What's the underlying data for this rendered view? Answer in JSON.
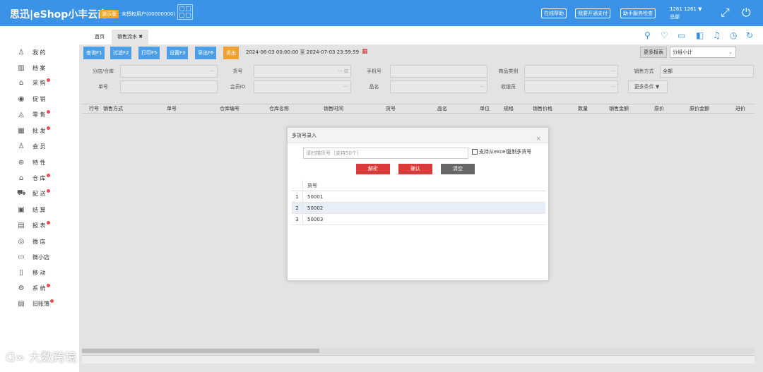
{
  "app": {
    "logo": "思迅|eShop小丰云商6",
    "demo_badge": "演示版",
    "unauthorized": "未授权用户(00000000)",
    "buttons": [
      "在线帮助",
      "我要开通支付",
      "助手服务检查"
    ],
    "user_line1": "1261 1261 ▼",
    "user_line2": "总部"
  },
  "sidebar": {
    "items": [
      {
        "label": "我 的",
        "icon": "user-icon",
        "dot": false
      },
      {
        "label": "档 案",
        "icon": "archive-icon",
        "dot": false
      },
      {
        "label": "采 购",
        "icon": "basket-icon",
        "dot": true
      },
      {
        "label": "促 销",
        "icon": "eye-icon",
        "dot": false
      },
      {
        "label": "零 售",
        "icon": "bag-icon",
        "dot": true
      },
      {
        "label": "批 发",
        "icon": "chart-icon",
        "dot": true
      },
      {
        "label": "会 员",
        "icon": "member-icon",
        "dot": false
      },
      {
        "label": "特 性",
        "icon": "target-icon",
        "dot": false
      },
      {
        "label": "仓 库",
        "icon": "warehouse-icon",
        "dot": true
      },
      {
        "label": "配 送",
        "icon": "truck-icon",
        "dot": true
      },
      {
        "label": "结 算",
        "icon": "settle-icon",
        "dot": false
      },
      {
        "label": "报 表",
        "icon": "report-icon",
        "dot": true
      },
      {
        "label": "微 店",
        "icon": "microstore-icon",
        "dot": false
      },
      {
        "label": "微小店",
        "icon": "shop-icon",
        "dot": false
      },
      {
        "label": "移 动",
        "icon": "mobile-icon",
        "dot": false
      },
      {
        "label": "系 统",
        "icon": "gear-icon",
        "dot": true
      },
      {
        "label": "旧账簿",
        "icon": "ledger-icon",
        "dot": true
      }
    ],
    "watermark": "大数跨境"
  },
  "tabs": {
    "home": "首页",
    "active": "销售流水",
    "close": "✖"
  },
  "toolbar": {
    "buttons": [
      "查询F1",
      "过滤F2",
      "打印F5",
      "设置F3",
      "导出F6",
      "退出"
    ],
    "date_range": "2024-06-03 00:00:00  至  2024-07-03 23:59:59",
    "more_reports": "更多报表",
    "group_select": "分组小计"
  },
  "filters": {
    "branch_label": "分店/仓库",
    "item_no_label": "货号",
    "phone_label": "手机号",
    "category_label": "商品类别",
    "sale_mode_label": "销售方式",
    "sale_mode_value": "全部",
    "order_no_label": "单号",
    "member_label": "会员ID",
    "name_label": "品名",
    "cashier_label": "收银员",
    "more_conditions": "更多条件 ▼",
    "ellipsis": "···",
    "ellipsis_icon": "··· ⊟"
  },
  "grid": {
    "columns": [
      "行号",
      "销售方式",
      "单号",
      "仓库编号",
      "仓库名称",
      "销售时间",
      "货号",
      "品名",
      "单位",
      "规格",
      "销售价格",
      "数量",
      "销售金额",
      "原价",
      "原价金额",
      "进价"
    ]
  },
  "dialog": {
    "title": "多货号录入",
    "close": "×",
    "input_placeholder": "请扫描货号（支持50个）",
    "excel_checkbox": "支持从excel复制多货号",
    "parse_button": "解析",
    "confirm_button": "确认",
    "clear_button": "清空",
    "table_header": "货号",
    "rows": [
      {
        "num": "1",
        "val": "50001"
      },
      {
        "num": "2",
        "val": "50002"
      },
      {
        "num": "3",
        "val": "50003"
      }
    ]
  }
}
